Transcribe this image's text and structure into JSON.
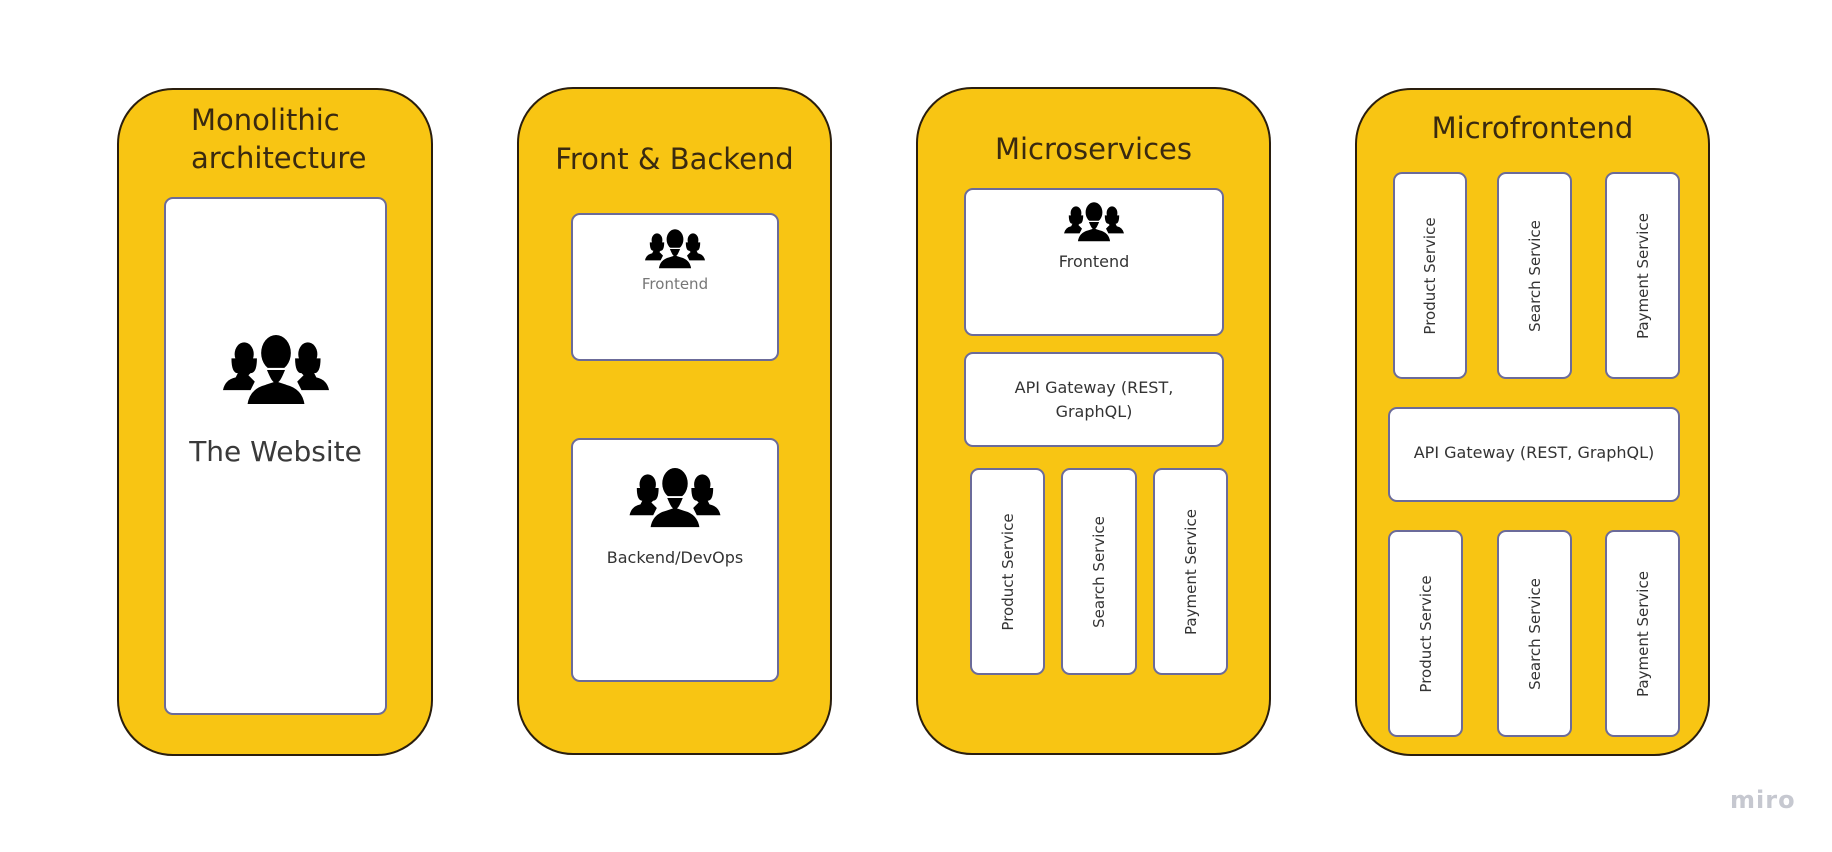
{
  "canvas": {
    "background": "#ffffff",
    "card_color": "#f8c513",
    "card_border_color": "#2a1e0e",
    "box_border_color": "#6b6b9a"
  },
  "cards": [
    {
      "title_line1": "Monolithic",
      "title_line2": "architecture",
      "boxes": [
        {
          "label": "The Website",
          "icon": "people-group-icon"
        }
      ]
    },
    {
      "title": "Front & Backend",
      "boxes": [
        {
          "label": "Frontend",
          "icon": "people-group-icon"
        },
        {
          "label": "Backend/DevOps",
          "icon": "people-group-icon"
        }
      ]
    },
    {
      "title": "Microservices",
      "boxes": [
        {
          "label": "Frontend",
          "icon": "people-group-icon"
        },
        {
          "label_line1": "API Gateway (REST,",
          "label_line2": "GraphQL)"
        }
      ],
      "services": [
        "Product Service",
        "Search Service",
        "Payment Service"
      ]
    },
    {
      "title": "Microfrontend",
      "top_services": [
        "Product Service",
        "Search Service",
        "Payment Service"
      ],
      "gateway": "API Gateway (REST, GraphQL)",
      "bottom_services": [
        "Product Service",
        "Search Service",
        "Payment Service"
      ]
    }
  ],
  "watermark": "miro"
}
